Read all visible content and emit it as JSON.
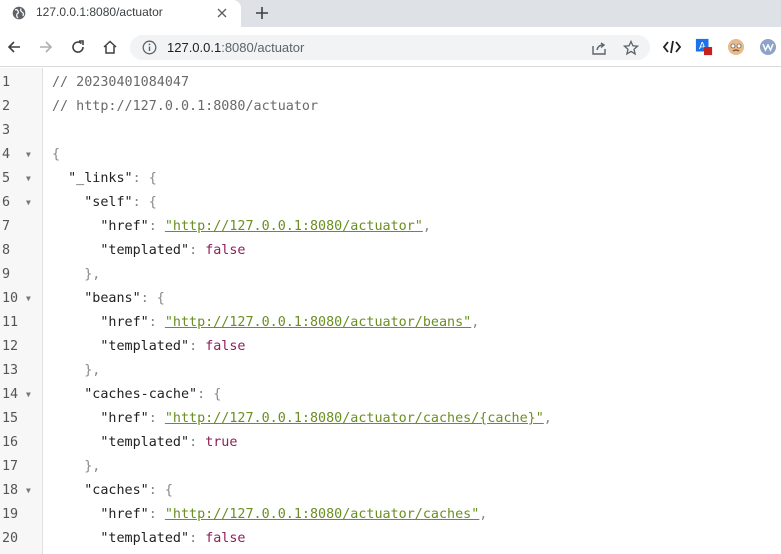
{
  "tab": {
    "title": "127.0.0.1:8080/actuator",
    "icon": "globe-icon"
  },
  "address": {
    "host": "127.0.0.1",
    "rest": ":8080/actuator"
  },
  "json_lines": [
    [
      {
        "t": "c",
        "v": "// 20230401084047"
      }
    ],
    [
      {
        "t": "c",
        "v": "// http://127.0.0.1:8080/actuator"
      }
    ],
    [],
    [
      {
        "t": "p",
        "v": "{"
      }
    ],
    [
      {
        "t": "k",
        "v": "  \"_links\""
      },
      {
        "t": "p",
        "v": ": {"
      }
    ],
    [
      {
        "t": "k",
        "v": "    \"self\""
      },
      {
        "t": "p",
        "v": ": {"
      }
    ],
    [
      {
        "t": "k",
        "v": "      \"href\""
      },
      {
        "t": "p",
        "v": ": "
      },
      {
        "t": "s",
        "v": "\"http://127.0.0.1:8080/actuator\""
      },
      {
        "t": "p",
        "v": ","
      }
    ],
    [
      {
        "t": "k",
        "v": "      \"templated\""
      },
      {
        "t": "p",
        "v": ": "
      },
      {
        "t": "b",
        "v": "false"
      }
    ],
    [
      {
        "t": "p",
        "v": "    },"
      }
    ],
    [
      {
        "t": "k",
        "v": "    \"beans\""
      },
      {
        "t": "p",
        "v": ": {"
      }
    ],
    [
      {
        "t": "k",
        "v": "      \"href\""
      },
      {
        "t": "p",
        "v": ": "
      },
      {
        "t": "s",
        "v": "\"http://127.0.0.1:8080/actuator/beans\""
      },
      {
        "t": "p",
        "v": ","
      }
    ],
    [
      {
        "t": "k",
        "v": "      \"templated\""
      },
      {
        "t": "p",
        "v": ": "
      },
      {
        "t": "b",
        "v": "false"
      }
    ],
    [
      {
        "t": "p",
        "v": "    },"
      }
    ],
    [
      {
        "t": "k",
        "v": "    \"caches-cache\""
      },
      {
        "t": "p",
        "v": ": {"
      }
    ],
    [
      {
        "t": "k",
        "v": "      \"href\""
      },
      {
        "t": "p",
        "v": ": "
      },
      {
        "t": "s",
        "v": "\"http://127.0.0.1:8080/actuator/caches/{cache}\""
      },
      {
        "t": "p",
        "v": ","
      }
    ],
    [
      {
        "t": "k",
        "v": "      \"templated\""
      },
      {
        "t": "p",
        "v": ": "
      },
      {
        "t": "b",
        "v": "true"
      }
    ],
    [
      {
        "t": "p",
        "v": "    },"
      }
    ],
    [
      {
        "t": "k",
        "v": "    \"caches\""
      },
      {
        "t": "p",
        "v": ": {"
      }
    ],
    [
      {
        "t": "k",
        "v": "      \"href\""
      },
      {
        "t": "p",
        "v": ": "
      },
      {
        "t": "s",
        "v": "\"http://127.0.0.1:8080/actuator/caches\""
      },
      {
        "t": "p",
        "v": ","
      }
    ],
    [
      {
        "t": "k",
        "v": "      \"templated\""
      },
      {
        "t": "p",
        "v": ": "
      },
      {
        "t": "b",
        "v": "false"
      }
    ]
  ],
  "line_numbers": [
    "1",
    "2",
    "3",
    "4",
    "5",
    "6",
    "7",
    "8",
    "9",
    "10",
    "11",
    "12",
    "13",
    "14",
    "15",
    "16",
    "17",
    "18",
    "19",
    "20"
  ],
  "fold_lines": [
    4,
    5,
    6,
    10,
    14,
    18
  ],
  "colors": {
    "string": "#6a8f22",
    "boolean": "#8e1f5b",
    "comment": "#6a6a6a",
    "extension_blue": "#1a73e8"
  },
  "extensions": [
    "code-brackets-icon",
    "translate-extension-icon",
    "pug-extension-icon",
    "wappalyzer-extension-icon"
  ],
  "extension_labels": {
    "translate": "A"
  }
}
